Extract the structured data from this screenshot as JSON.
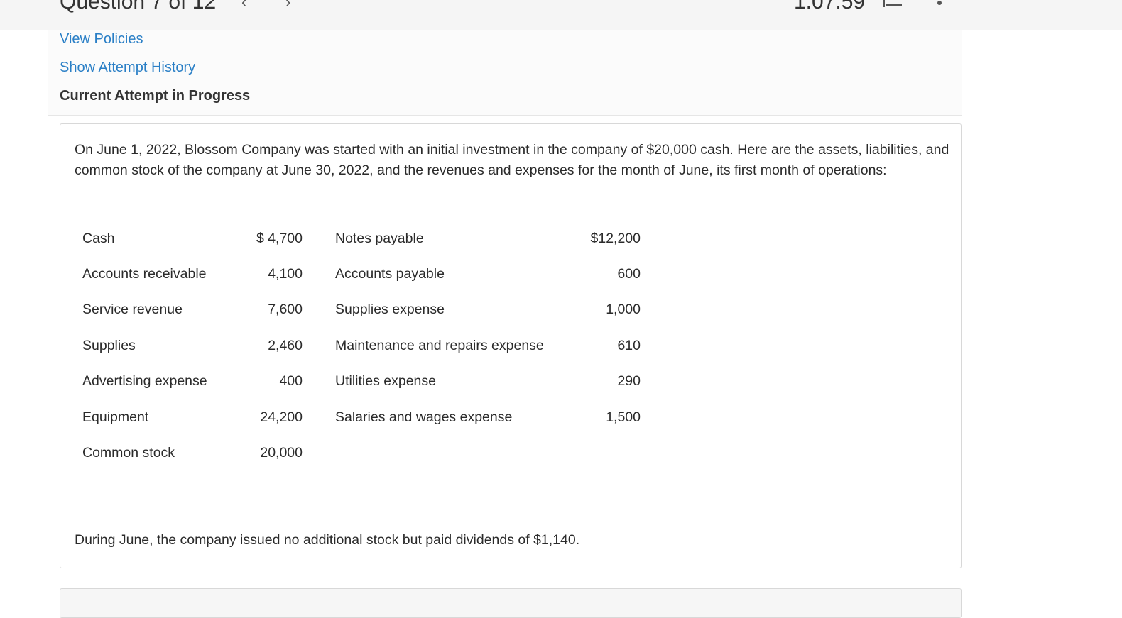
{
  "topbar": {
    "question_label": "Question 7 of 12",
    "prev_glyph": "‹",
    "next_glyph": "›",
    "timer": "1:07:59"
  },
  "links": {
    "view_policies": "View Policies",
    "show_attempt_history": "Show Attempt History"
  },
  "current_attempt": "Current Attempt in Progress",
  "question": {
    "intro": "On June 1, 2022, Blossom Company was started with an initial investment in the company of $20,000 cash. Here are the assets, liabilities, and common stock of the company at June 30, 2022, and the revenues and expenses for the month of June, its first month of operations:",
    "rows": [
      {
        "name1": "Cash",
        "amt1": "$ 4,700",
        "name2": "Notes payable",
        "amt2": "$12,200"
      },
      {
        "name1": "Accounts receivable",
        "amt1": "4,100",
        "name2": "Accounts payable",
        "amt2": "600"
      },
      {
        "name1": "Service revenue",
        "amt1": "7,600",
        "name2": "Supplies expense",
        "amt2": "1,000"
      },
      {
        "name1": "Supplies",
        "amt1": "2,460",
        "name2": "Maintenance and repairs expense",
        "amt2": "610"
      },
      {
        "name1": "Advertising expense",
        "amt1": "400",
        "name2": "Utilities expense",
        "amt2": "290"
      },
      {
        "name1": "Equipment",
        "amt1": "24,200",
        "name2": "Salaries and wages expense",
        "amt2": "1,500"
      },
      {
        "name1": "Common stock",
        "amt1": "20,000",
        "name2": "",
        "amt2": ""
      }
    ],
    "closing": "During June, the company issued no additional stock but paid dividends of $1,140."
  }
}
